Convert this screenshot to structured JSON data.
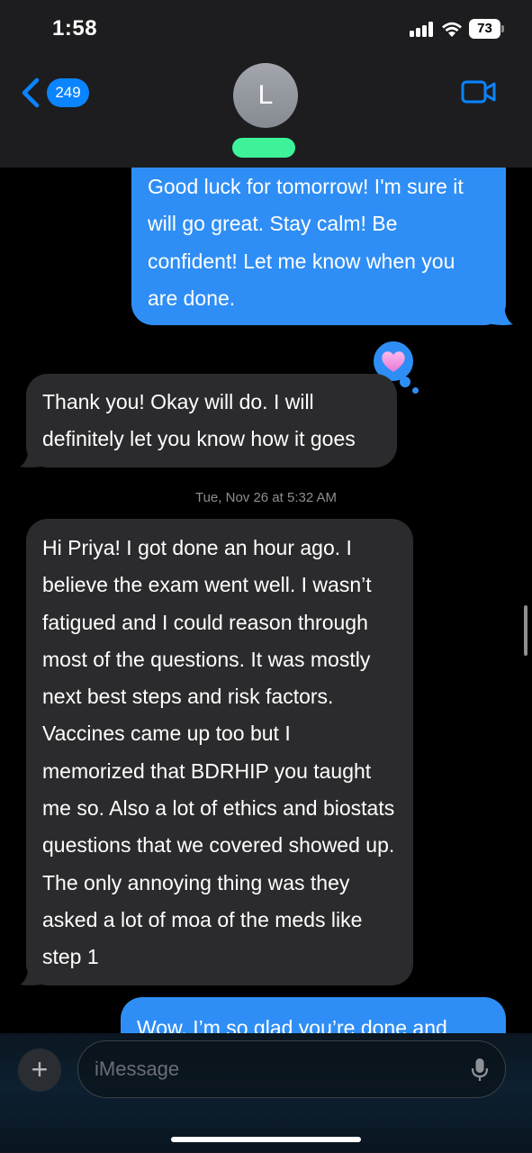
{
  "status_bar": {
    "time": "1:58",
    "battery": "73"
  },
  "header": {
    "back_count": "249",
    "avatar_initial": "L"
  },
  "messages": [
    {
      "direction": "sent",
      "text": "Good luck for tomorrow! I'm sure it will go great. Stay calm! Be confident! Let me know when you are done."
    },
    {
      "direction": "received",
      "text": "Thank you!  Okay will do. I will definitely let you know how it goes",
      "tapback": "heart"
    },
    {
      "direction": "received",
      "text": "Hi Priya! I got done an hour ago. I believe the exam went well. I wasn’t fatigued and I could reason through most of the questions. It was mostly next best steps and risk factors. Vaccines came up too but I memorized that BDRHIP you taught me so. Also a lot of ethics and biostats questions that we covered showed up. The only annoying thing was they asked a lot of moa of the meds like step 1"
    },
    {
      "direction": "sent",
      "text": "Wow, I’m so glad you’re done and"
    }
  ],
  "timestamp": "Tue, Nov 26 at 5:32 AM",
  "composer": {
    "placeholder": "iMessage"
  },
  "colors": {
    "sent_bubble": "#2f8ef5",
    "received_bubble": "#2b2b2d",
    "accent": "#0a84ff",
    "redaction": "#3ef29a"
  }
}
